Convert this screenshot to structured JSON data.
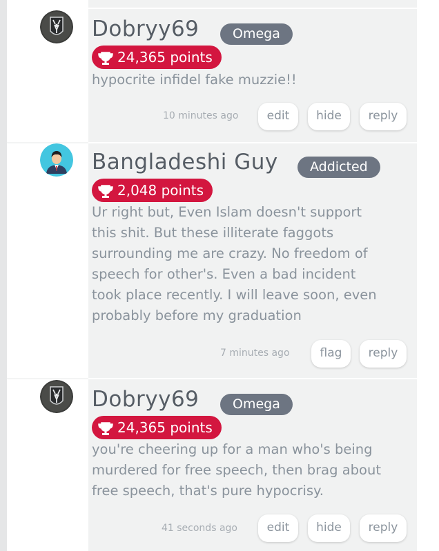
{
  "comments": [
    {
      "username": "Dobryy69",
      "rank": "Omega",
      "points": "24,365 points",
      "avatar": "stag-emblem-avatar",
      "text": "hypocrite infidel fake muzzie!!",
      "timestamp": "10 minutes ago",
      "actions": [
        "edit",
        "hide",
        "reply"
      ]
    },
    {
      "username": "Bangladeshi Guy",
      "rank": "Addicted",
      "points": "2,048 points",
      "avatar": "person-in-suit-avatar",
      "text_lines": [
        "Ur right but, Even Islam doesn't support",
        "this shit. But these illiterate faggots",
        "surrounding me are crazy. No freedom of",
        "speech for other's. Even a bad incident",
        "took place recently. I will leave soon, even",
        "probably before my graduation"
      ],
      "timestamp": "7 minutes ago",
      "actions": [
        "flag",
        "reply"
      ]
    },
    {
      "username": "Dobryy69",
      "rank": "Omega",
      "points": "24,365 points",
      "avatar": "stag-emblem-avatar",
      "text_lines": [
        "you're cheering up for a man who's being",
        "murdered for free speech, then brag about",
        "free speech, that's pure hypocrisy."
      ],
      "timestamp": "41 seconds ago",
      "actions": [
        "edit",
        "hide",
        "reply"
      ]
    }
  ],
  "colors": {
    "points_badge": "#d3163f",
    "rank_badge": "#6d7582",
    "username": "#565d65",
    "body_text": "#8a939c",
    "card_background": "#f1f2f2"
  }
}
